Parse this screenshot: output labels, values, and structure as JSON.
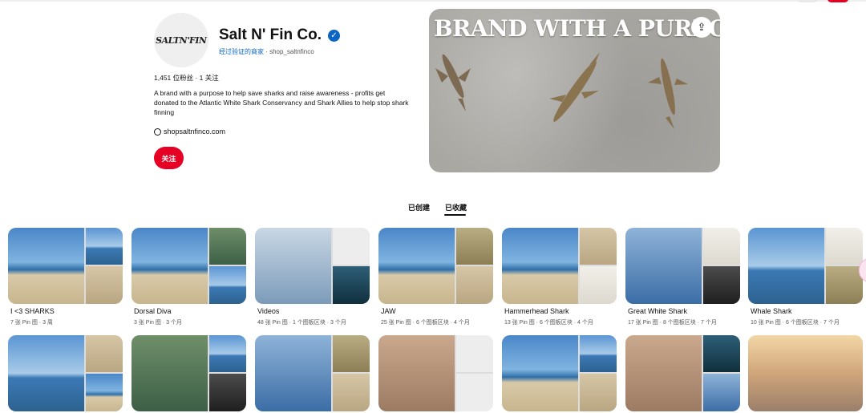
{
  "profile": {
    "logo_text": "SALTN'FIN",
    "name": "Salt N' Fin Co.",
    "verified_label": "经过验证的商家",
    "handle_separator": " · ",
    "handle": "shop_saltnfinco",
    "stats": "1,451 位粉丝 · 1 关注",
    "bio": "A brand with a purpose to help save sharks and raise awareness - profits get donated to the Atlantic White Shark Conservancy and Shark Allies to help stop shark finning",
    "website": "shopsaltnfinco.com",
    "follow_label": "关注"
  },
  "banner": {
    "title": "BRAND WITH A PURPOSE"
  },
  "tabs": [
    {
      "label": "已创建",
      "active": false
    },
    {
      "label": "已收藏",
      "active": true
    }
  ],
  "boards": [
    {
      "name": "I <3 SHARKS",
      "meta": "7 张 Pin 图 · 3 周"
    },
    {
      "name": "Dorsal Diva",
      "meta": "3 张 Pin 图 · 3 个月"
    },
    {
      "name": "Videos",
      "meta": "48 张 Pin 图 · 1 个图板区块 · 3 个月"
    },
    {
      "name": "JAW",
      "meta": "25 张 Pin 图 · 6 个图板区块 · 4 个月"
    },
    {
      "name": "Hammerhead Shark",
      "meta": "13 张 Pin 图 · 6 个图板区块 · 4 个月"
    },
    {
      "name": "Great White Shark",
      "meta": "17 张 Pin 图 · 8 个图板区块 · 7 个月"
    },
    {
      "name": "Whale Shark",
      "meta": "10 张 Pin 图 · 6 个图板区块 · 7 个月"
    }
  ],
  "colors": {
    "accent": "#e60023",
    "verified": "#0a66c2"
  },
  "icons": [
    "verified-icon",
    "globe-icon",
    "share-icon"
  ]
}
